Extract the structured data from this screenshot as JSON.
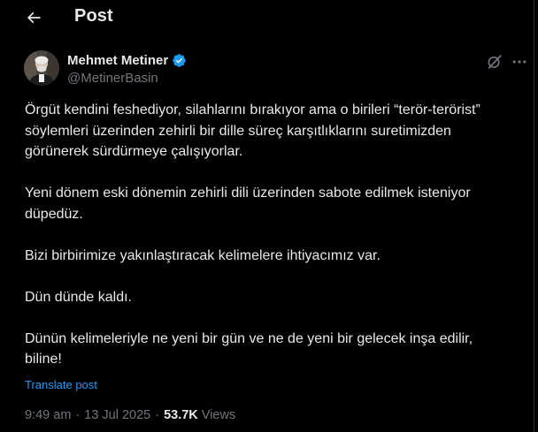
{
  "header": {
    "back_icon": "arrow-left-icon",
    "title": "Post"
  },
  "author": {
    "name": "Mehmet Metiner",
    "handle": "@MetinerBasin",
    "verified": true,
    "verified_color": "#1d9bf0"
  },
  "actions": {
    "grok_icon": "grok-icon",
    "more_icon": "more-horizontal-icon"
  },
  "tweet": {
    "paragraphs": [
      "Örgüt kendini feshediyor, silahlarını bırakıyor ama o birileri “terör-terörist” söylemleri üzerinden zehirli bir dille süreç karşıtlıklarını suretimizden görünerek sürdürmeye çalışıyorlar.",
      "Yeni dönem eski dönemin zehirli dili üzerinden sabote edilmek isteniyor düpedüz.",
      "Bizi birbirimize yakınlaştıracak kelimelere ihtiyacımız var.",
      "Dün dünde kaldı.",
      "Dünün kelimeleriyle ne yeni bir gün ve ne de yeni bir gelecek inşa edilir, biline!"
    ],
    "translate_label": "Translate post"
  },
  "meta": {
    "time": "9:49 am",
    "separator": "·",
    "date": "13 Jul 2025",
    "views_count": "53.7K",
    "views_label": "Views"
  },
  "colors": {
    "background": "#000000",
    "text": "#e7e9ea",
    "secondary": "#71767b",
    "accent": "#1d9bf0",
    "border": "#2f3336"
  }
}
